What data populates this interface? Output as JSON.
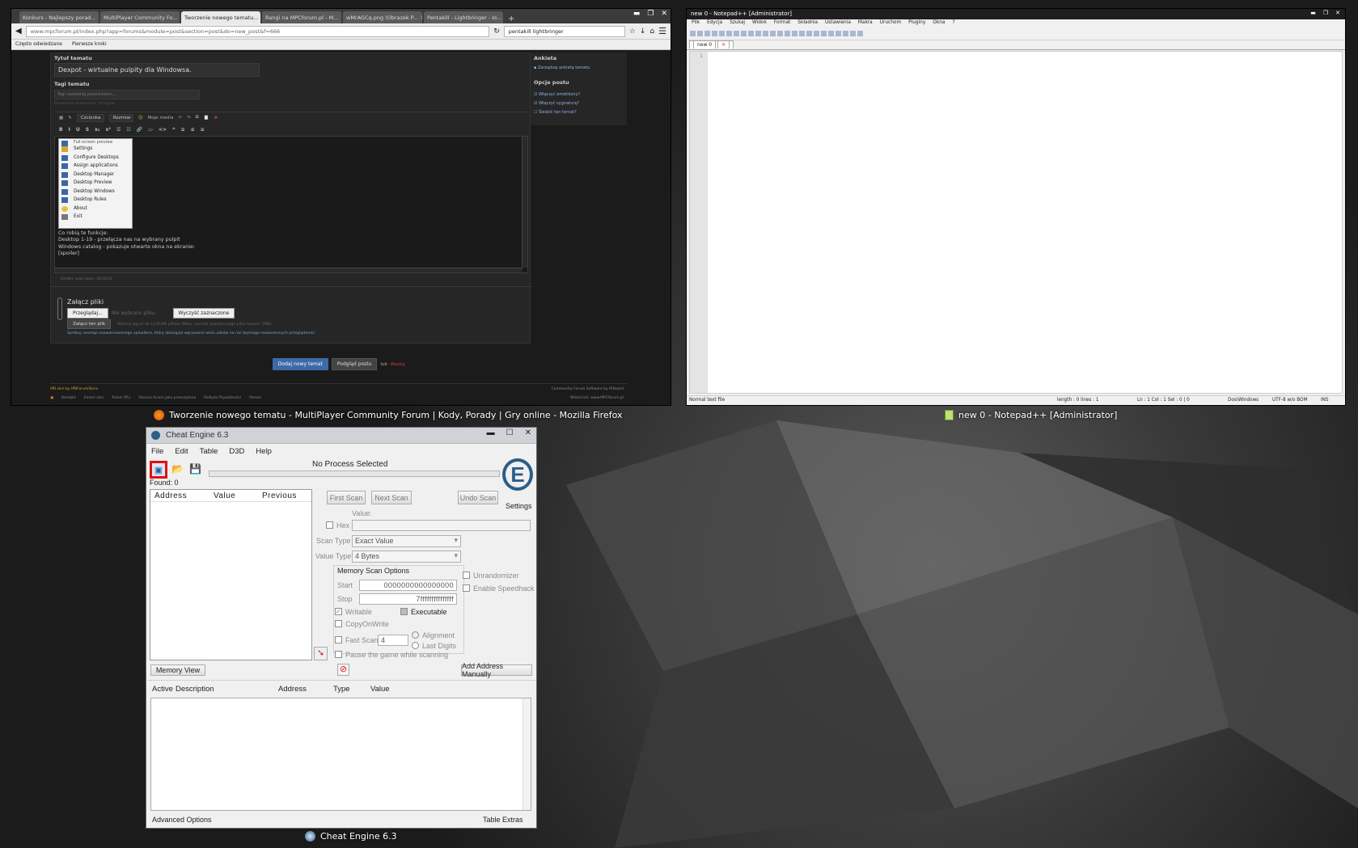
{
  "firefox": {
    "tabs": [
      "Konkurs - Najlepszy porad...",
      "MultiPlayer Community Fo...",
      "Tworzenie nowego tematu...",
      "Rangi na MPCforum.pl - M...",
      "wMrAGCq.png (Obrazek P...",
      "Pentakill - Lightbringer - Io..."
    ],
    "url": "www.mpcforum.pl/index.php?app=forums&module=post&section=post&do=new_post&f=666",
    "search": "pentakill lightbringer",
    "bookmarks": [
      "Często odwiedzane",
      "Pierwsze kroki"
    ],
    "form": {
      "title_label": "Tytuł tematu",
      "title_value": "Dexpot - wirtualne pulpity dla Windowsa.",
      "tags_label": "Tagi tematu",
      "tags_placeholder": "Tagi rozdzielaj przecinkiem....",
      "tags_hint": "Dozwolone maksimum: 10 tagów",
      "font_label": "Czcionka",
      "size_label": "Rozmiar",
      "media_label": "Moje media",
      "context_menu": [
        "Full-screen preview",
        "Settings",
        "Configure Desktops",
        "Assign applications",
        "Desktop Manager",
        "Desktop Preview",
        "Desktop Windows",
        "Desktop Rules",
        "About",
        "Exit"
      ],
      "body_lines": [
        "Co robią te funkcje:",
        "Desktop 1-19 - przełącza nas na wybrany pulpit",
        "Windows catalog - pokazuje otwarte okna na ekranie:",
        "[spoiler]"
      ],
      "autosave": "Ostatni auto zapis: 18:58:02",
      "attach_title": "Załącz pliki",
      "browse_btn": "Przeglądaj...",
      "no_file": "Nie wybrano pliku.",
      "clear_btn": "Wyczyść zaznaczone",
      "attach_btn": "Załącz ten plik",
      "attach_info": "Możesz wgrać do 13,91MB plików (Maks. rozmiar pojedynczego pliku wynosi: 2MB)",
      "uploader_hint": "Spróbuj naszego zaawansowanego uploadera, który obsługuje wgrywanie wielu plików na raz (wymaga nowoczesnych przeglądarek)",
      "submit_btn": "Dodaj nowy temat",
      "preview_btn": "Podgląd postu",
      "or": "lub",
      "cancel": "Anuluj"
    },
    "sidebar": {
      "poll_title": "Ankieta",
      "poll_item": "Zarządzaj ankietą tematu",
      "options_title": "Opcje postu",
      "options": [
        "Włączyć emotikony?",
        "Włączyć sygnaturę?",
        "Śledzić ten temat?"
      ]
    },
    "footer": {
      "skin": "IPB skin by IPBForumSkins",
      "links": [
        "Kontakt",
        "Zmień skin",
        "Polish (PL)",
        "Oznacz forum jako przeczytane",
        "Polityka Prywatności",
        "Pomoc"
      ],
      "software": "Community Forum Software by IP.Board",
      "owner": "Właściciel: www.MPCforum.pl"
    }
  },
  "taskbar_labels": {
    "firefox": "Tworzenie nowego tematu - MultiPlayer Community Forum | Kody, Porady | Gry online - Mozilla Firefox",
    "notepad": "new  0 - Notepad++ [Administrator]",
    "cheatengine": "Cheat Engine 6.3"
  },
  "notepad": {
    "title": "new 0 - Notepad++ [Administrator]",
    "menu": [
      "Plik",
      "Edycja",
      "Szukaj",
      "Widok",
      "Format",
      "Składnia",
      "Ustawienia",
      "Makra",
      "Uruchom",
      "Pluginy",
      "Okna",
      "?"
    ],
    "tab": "new 0",
    "line": "1",
    "status": {
      "type": "Normal text file",
      "length": "length : 0    lines : 1",
      "pos": "Ln : 1    Col : 1    Sel : 0 | 0",
      "eol": "Dos\\Windows",
      "enc": "UTF-8 w/o BOM",
      "ins": "INS"
    }
  },
  "cheatengine": {
    "title": "Cheat Engine 6.3",
    "menu": [
      "File",
      "Edit",
      "Table",
      "D3D",
      "Help"
    ],
    "process": "No Process Selected",
    "found": "Found: 0",
    "list_headers": [
      "Address",
      "Value",
      "Previous"
    ],
    "first_scan": "First Scan",
    "next_scan": "Next Scan",
    "undo_scan": "Undo Scan",
    "settings": "Settings",
    "value_label": "Value:",
    "hex": "Hex",
    "scan_type_label": "Scan Type",
    "scan_type": "Exact Value",
    "value_type_label": "Value Type",
    "value_type": "4 Bytes",
    "mem_opts": "Memory Scan Options",
    "start_label": "Start",
    "start": "0000000000000000",
    "stop_label": "Stop",
    "stop": "7fffffffffffffff",
    "writable": "Writable",
    "executable": "Executable",
    "copyonwrite": "CopyOnWrite",
    "fastscan": "Fast Scan",
    "fastscan_val": "4",
    "alignment": "Alignment",
    "lastdigits": "Last Digits",
    "pause": "Pause the game while scanning",
    "unrandomizer": "Unrandomizer",
    "speedhack": "Enable Speedhack",
    "memory_view": "Memory View",
    "add_manual": "Add Address Manually",
    "table_headers": [
      "Active",
      "Description",
      "Address",
      "Type",
      "Value"
    ],
    "advanced": "Advanced Options",
    "extras": "Table Extras"
  }
}
